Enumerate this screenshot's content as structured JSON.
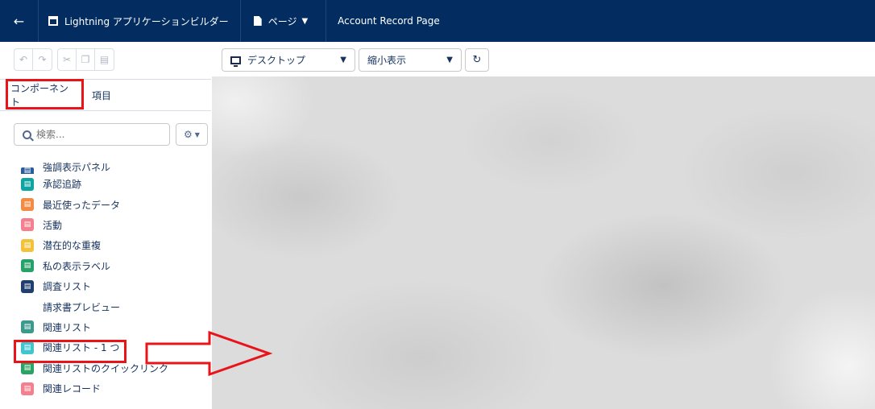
{
  "header": {
    "back_icon": "arrow-left-icon",
    "app_name": "Lightning アプリケーションビルダー",
    "page_menu_label": "ページ",
    "record_page_name": "Account Record Page",
    "background_color": "#032d60"
  },
  "undo_toolbar": {
    "icons": [
      "undo-icon",
      "redo-icon",
      "cut-icon",
      "copy-icon",
      "paste-icon"
    ]
  },
  "view_toolbar": {
    "device_selected": "デスクトップ",
    "zoom_selected": "縮小表示",
    "refresh_icon": "refresh-icon"
  },
  "left_panel": {
    "tabs": [
      {
        "label": "コンポーネント",
        "active": true
      },
      {
        "label": "項目",
        "active": false
      }
    ],
    "search": {
      "placeholder": "検索..."
    },
    "settings_icon": "gear-icon",
    "components": [
      {
        "label": "強調表示パネル",
        "color": "#2a5d9a",
        "icon": "highlights-panel-icon"
      },
      {
        "label": "承認追跡",
        "color": "#0ea4a2",
        "icon": "approval-icon"
      },
      {
        "label": "最近使ったデータ",
        "color": "#f28b43",
        "icon": "clock-icon"
      },
      {
        "label": "活動",
        "color": "#f47f8e",
        "icon": "activity-icon"
      },
      {
        "label": "潜在的な重複",
        "color": "#f3c23b",
        "icon": "duplicate-icon"
      },
      {
        "label": "私の表示ラベル",
        "color": "#27a168",
        "icon": "tag-icon"
      },
      {
        "label": "調査リスト",
        "color": "#223e6e",
        "icon": "survey-icon"
      },
      {
        "label": "請求書プレビュー",
        "color": "",
        "icon": ""
      },
      {
        "label": "関連リスト",
        "color": "#3c9a8c",
        "icon": "related-list-icon"
      },
      {
        "label": "関連リスト - 1 つ",
        "color": "#3fc6cf",
        "icon": "related-list-single-icon"
      },
      {
        "label": "関連リストのクイックリンク",
        "color": "#2ba364",
        "icon": "related-list-quicklinks-icon"
      },
      {
        "label": "関連レコード",
        "color": "#f47f8e",
        "icon": "related-record-icon"
      }
    ]
  },
  "annotation_color": "#e8141a"
}
